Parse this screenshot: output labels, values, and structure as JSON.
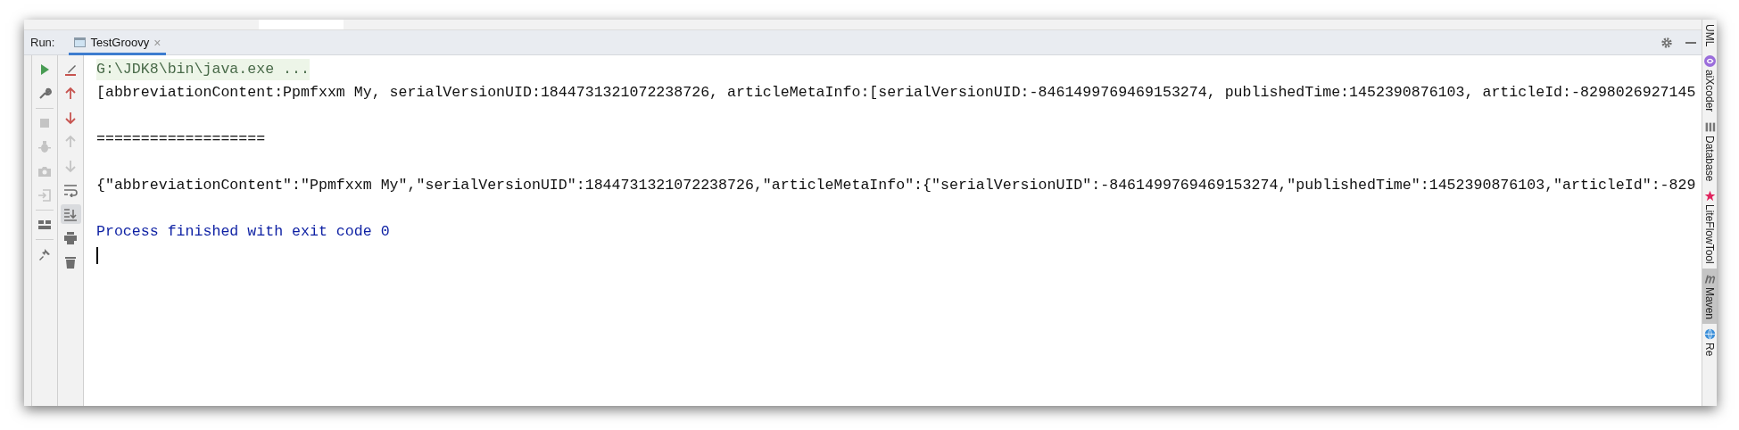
{
  "run_bar": {
    "label": "Run:",
    "tabs": [
      {
        "label": "TestGroovy",
        "close": "×",
        "selected": true
      }
    ]
  },
  "toolbar_left": [
    {
      "kind": "run",
      "disabled": false
    },
    {
      "kind": "wrench",
      "disabled": false
    },
    {
      "kind": "divider"
    },
    {
      "kind": "stop",
      "disabled": true
    },
    {
      "kind": "bug",
      "disabled": true
    },
    {
      "kind": "camera",
      "disabled": true
    },
    {
      "kind": "exit",
      "disabled": true
    },
    {
      "kind": "divider"
    },
    {
      "kind": "layout",
      "disabled": false
    },
    {
      "kind": "divider"
    },
    {
      "kind": "pin",
      "disabled": false
    }
  ],
  "toolbar_right": [
    {
      "kind": "clear",
      "disabled": false,
      "selected": false
    },
    {
      "kind": "up",
      "disabled": false,
      "selected": false
    },
    {
      "kind": "down",
      "disabled": false,
      "selected": false
    },
    {
      "kind": "up",
      "disabled": true,
      "selected": false
    },
    {
      "kind": "down",
      "disabled": true,
      "selected": false
    },
    {
      "kind": "wrap",
      "disabled": false,
      "selected": false
    },
    {
      "kind": "scroll",
      "disabled": false,
      "selected": true
    },
    {
      "kind": "print",
      "disabled": false,
      "selected": false
    },
    {
      "kind": "trash",
      "disabled": false,
      "selected": false
    }
  ],
  "console": [
    {
      "kind": "command",
      "text": "G:\\JDK8\\bin\\java.exe ..."
    },
    {
      "kind": "output",
      "text": "[abbreviationContent:Ppmfxxm My, serialVersionUID:1844731321072238726, articleMetaInfo:[serialVersionUID:-8461499769469153274, publishedTime:1452390876103, articleId:-8298026927145"
    },
    {
      "kind": "blank"
    },
    {
      "kind": "output",
      "text": "==================="
    },
    {
      "kind": "blank"
    },
    {
      "kind": "output",
      "text": "{\"abbreviationContent\":\"Ppmfxxm My\",\"serialVersionUID\":1844731321072238726,\"articleMetaInfo\":{\"serialVersionUID\":-8461499769469153274,\"publishedTime\":1452390876103,\"articleId\":-829"
    },
    {
      "kind": "blank"
    },
    {
      "kind": "system",
      "text": "Process finished with exit code 0"
    },
    {
      "kind": "cursor"
    }
  ],
  "right_tools": [
    {
      "label": "UML",
      "kind": "plain",
      "selected": false
    },
    {
      "label": "aiXcoder",
      "kind": "aix",
      "selected": false
    },
    {
      "label": "Database",
      "kind": "db",
      "selected": false
    },
    {
      "label": "LiteFlowTool",
      "kind": "star",
      "selected": false
    },
    {
      "label": "Maven",
      "kind": "m",
      "selected": true
    },
    {
      "label": "Re",
      "kind": "globe",
      "selected": false
    }
  ]
}
